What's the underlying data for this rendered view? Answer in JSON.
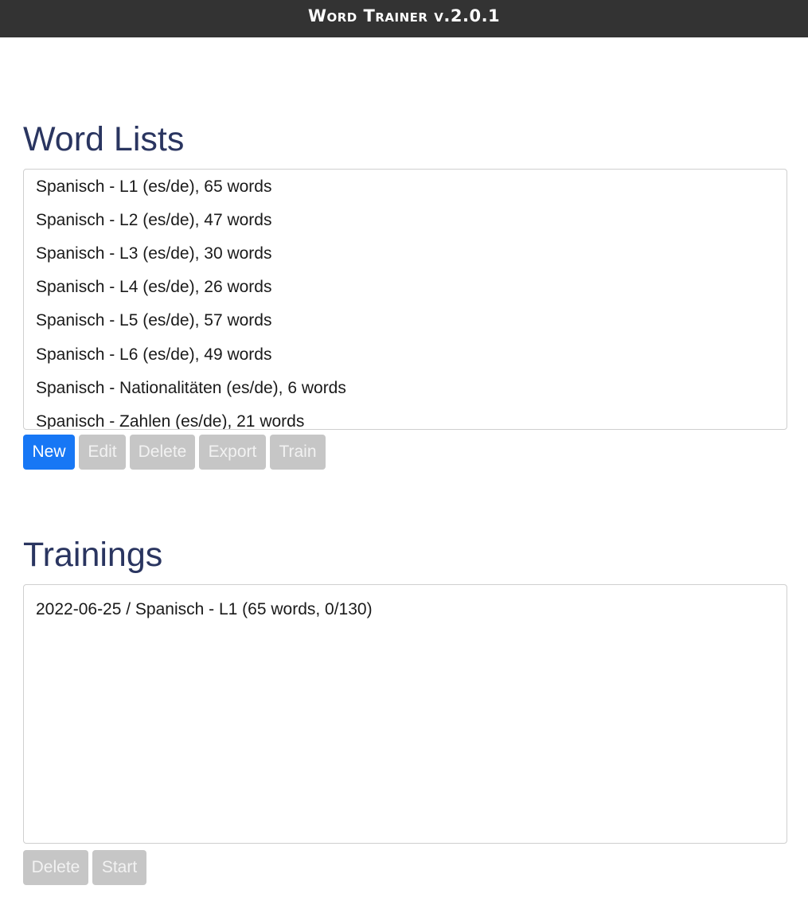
{
  "app": {
    "title": "Word Trainer v.2.0.1"
  },
  "word_lists": {
    "heading": "Word Lists",
    "items": [
      "Spanisch - L1 (es/de), 65 words",
      "Spanisch - L2 (es/de), 47 words",
      "Spanisch - L3 (es/de), 30 words",
      "Spanisch - L4 (es/de), 26 words",
      "Spanisch - L5 (es/de), 57 words",
      "Spanisch - L6 (es/de), 49 words",
      "Spanisch - Nationalitäten (es/de), 6 words",
      "Spanisch - Zahlen (es/de), 21 words"
    ],
    "buttons": {
      "new": "New",
      "edit": "Edit",
      "delete": "Delete",
      "export": "Export",
      "train": "Train"
    }
  },
  "trainings": {
    "heading": "Trainings",
    "items": [
      "2022-06-25 / Spanisch - L1 (65 words, 0/130)"
    ],
    "buttons": {
      "delete": "Delete",
      "start": "Start"
    }
  },
  "colors": {
    "titlebar_bg": "#333333",
    "heading": "#2a3560",
    "primary_button": "#1777f5",
    "disabled_button": "#c6c6c6"
  }
}
